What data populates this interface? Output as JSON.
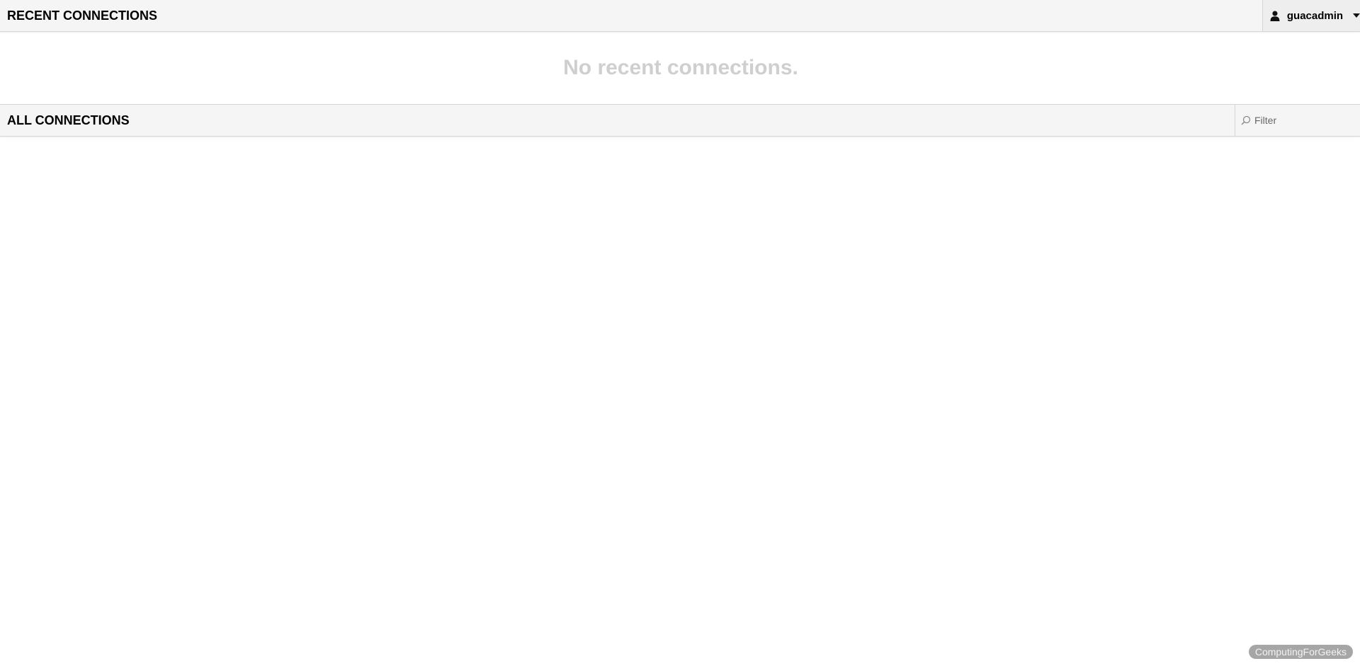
{
  "recent_connections": {
    "title": "RECENT CONNECTIONS",
    "empty_message": "No recent connections."
  },
  "user_menu": {
    "username": "guacadmin",
    "icon": "user-icon",
    "dropdown_icon": "chevron-down-icon"
  },
  "all_connections": {
    "title": "ALL CONNECTIONS",
    "filter": {
      "placeholder": "Filter",
      "value": "",
      "icon": "search-icon"
    }
  },
  "watermark": {
    "text": "ComputingForGeeks"
  },
  "colors": {
    "header_bg": "#f5f5f5",
    "border": "#d6d6d6",
    "empty_text": "#cfcfcf",
    "watermark_bg": "#a6a6a6"
  }
}
